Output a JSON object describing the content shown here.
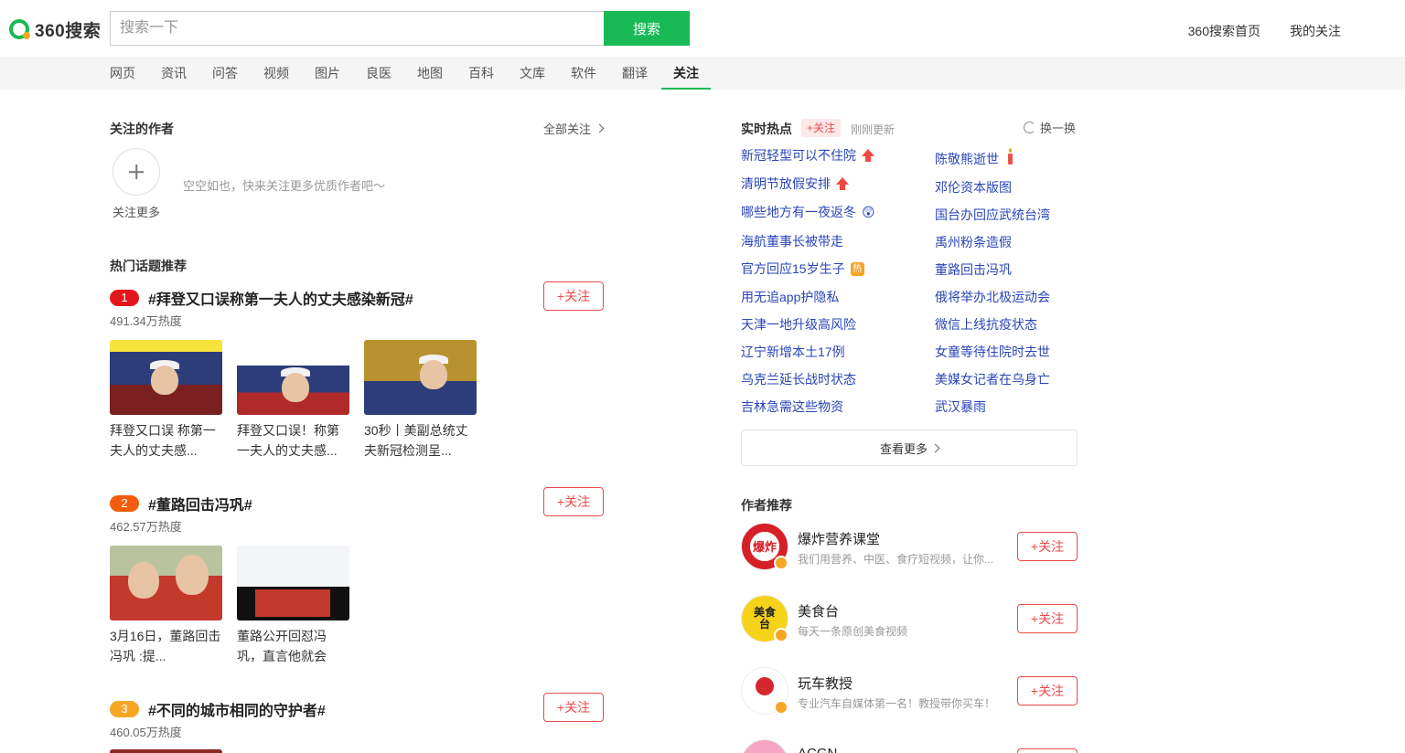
{
  "header": {
    "logo_text": "360搜索",
    "search_placeholder": "搜索一下",
    "search_button": "搜索",
    "links": [
      "360搜索首页",
      "我的关注"
    ]
  },
  "nav": {
    "tabs": [
      "网页",
      "资讯",
      "问答",
      "视频",
      "图片",
      "良医",
      "地图",
      "百科",
      "文库",
      "软件",
      "翻译",
      "关注"
    ],
    "active": "关注"
  },
  "followed": {
    "title": "关注的作者",
    "all_link": "全部关注",
    "add_label": "关注更多",
    "empty_text": "空空如也，快来关注更多优质作者吧～"
  },
  "hot_topics": {
    "title": "热门话题推荐",
    "follow_label": "+关注",
    "items": [
      {
        "rank": "1",
        "name": "#拜登又口误称第一夫人的丈夫感染新冠#",
        "heat": "491.34万热度",
        "thumbs": [
          {
            "caption": "拜登又口误 称第一夫人的丈夫感..."
          },
          {
            "caption": "拜登又口误！称第一夫人的丈夫感..."
          },
          {
            "caption": "30秒丨美副总统丈夫新冠检测呈..."
          }
        ]
      },
      {
        "rank": "2",
        "name": "#董路回击冯巩#",
        "heat": "462.57万热度",
        "thumbs": [
          {
            "caption": "3月16日，董路回击冯巩 :提..."
          },
          {
            "caption": "董路公开回怼冯巩，直言他就会"
          }
        ]
      },
      {
        "rank": "3",
        "name": "#不同的城市相同的守护者#",
        "heat": "460.05万热度",
        "thumbs": []
      }
    ]
  },
  "realtime": {
    "title": "实时热点",
    "follow_label": "+关注",
    "updated": "刚刚更新",
    "refresh": "换一换",
    "left": [
      {
        "text": "新冠轻型可以不住院",
        "icon": "up-arrow-icon"
      },
      {
        "text": "清明节放假安排",
        "icon": "up-arrow-icon"
      },
      {
        "text": "哪些地方有一夜返冬",
        "icon": "thinking-emoji-icon"
      },
      {
        "text": "海航董事长被带走",
        "icon": ""
      },
      {
        "text": "官方回应15岁生子",
        "icon": "hot-badge-icon"
      },
      {
        "text": "用无追app护隐私",
        "icon": ""
      },
      {
        "text": "天津一地升级高风险",
        "icon": ""
      },
      {
        "text": "辽宁新增本土17例",
        "icon": ""
      },
      {
        "text": "乌克兰延长战时状态",
        "icon": ""
      },
      {
        "text": "吉林急需这些物资",
        "icon": ""
      }
    ],
    "right": [
      {
        "text": "陈敬熊逝世",
        "icon": "candle-icon"
      },
      {
        "text": "邓伦资本版图",
        "icon": ""
      },
      {
        "text": "国台办回应武统台湾",
        "icon": ""
      },
      {
        "text": "禹州粉条造假",
        "icon": ""
      },
      {
        "text": "董路回击冯巩",
        "icon": ""
      },
      {
        "text": "俄将举办北极运动会",
        "icon": ""
      },
      {
        "text": "微信上线抗疫状态",
        "icon": ""
      },
      {
        "text": "女童等待住院时去世",
        "icon": ""
      },
      {
        "text": "美媒女记者在乌身亡",
        "icon": ""
      },
      {
        "text": "武汉暴雨",
        "icon": ""
      }
    ],
    "hot_badge": "热",
    "more": "查看更多"
  },
  "authors": {
    "title": "作者推荐",
    "follow_label": "+关注",
    "items": [
      {
        "name": "爆炸营养课堂",
        "desc": "我们用营养、中医、食疗短视频，让你...",
        "avatar_text": "爆炸"
      },
      {
        "name": "美食台",
        "desc": "每天一条原创美食视频",
        "avatar_text": "美食台"
      },
      {
        "name": "玩车教授",
        "desc": "专业汽车自媒体第一名！教授带你买车！",
        "avatar_text": ""
      },
      {
        "name": "ACGN",
        "desc": "",
        "avatar_text": ""
      }
    ]
  },
  "colors": {
    "brand_green": "#19b955",
    "follow_red": "#e94b4b",
    "link_blue": "#2a45b8"
  }
}
